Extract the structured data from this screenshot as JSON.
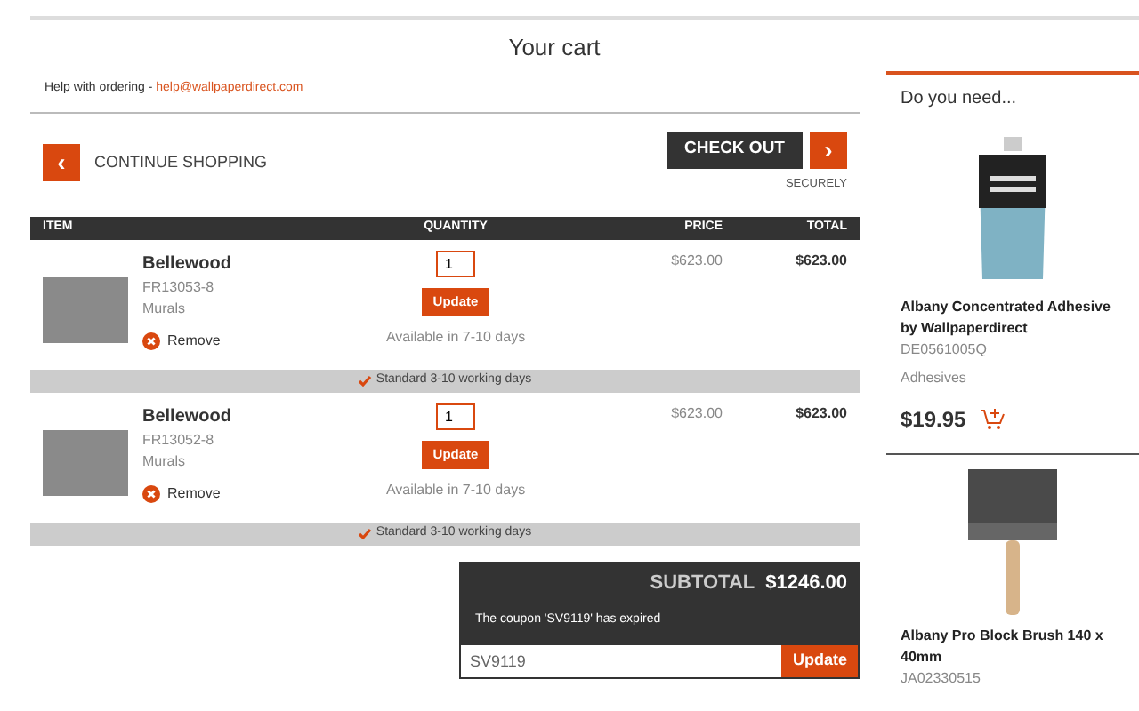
{
  "page_title": "Your cart",
  "help": {
    "label": "Help with ordering - ",
    "email": "help@wallpaperdirect.com"
  },
  "continue_button": {
    "icon": "‹",
    "label": "CONTINUE SHOPPING"
  },
  "checkout_button": {
    "label": "CHECK OUT",
    "icon": "›",
    "note": "SECURELY"
  },
  "table": {
    "columns": [
      "ITEM",
      "QUANTITY",
      "PRICE",
      "TOTAL"
    ],
    "rows": [
      {
        "name": "Bellewood",
        "code": "FR13053-8",
        "category": "Murals",
        "remove": "Remove",
        "quantity": "1",
        "update": "Update",
        "availability": "Available in 7-10 days",
        "price": "$623.00",
        "total": "$623.00",
        "shipping": "Standard 3-10 working days"
      },
      {
        "name": "Bellewood",
        "code": "FR13052-8",
        "category": "Murals",
        "remove": "Remove",
        "quantity": "1",
        "update": "Update",
        "availability": "Available in 7-10 days",
        "price": "$623.00",
        "total": "$623.00",
        "shipping": "Standard 3-10 working days"
      }
    ]
  },
  "summary": {
    "subtotal_label": "SUBTOTAL",
    "subtotal": "$1246.00",
    "message": "The coupon 'SV9119' has expired",
    "coupon_value": "SV9119",
    "update": "Update"
  },
  "sidebar": {
    "title": "Do you need...",
    "products": [
      {
        "kind": "adhesive",
        "name": "Albany Concentrated Adhesive by Wallpaperdirect",
        "code": "DE0561005Q",
        "category": "Adhesives",
        "price": "$19.95"
      },
      {
        "kind": "brush",
        "name": "Albany Pro Block Brush 140 x 40mm",
        "code": "JA02330515"
      }
    ]
  }
}
